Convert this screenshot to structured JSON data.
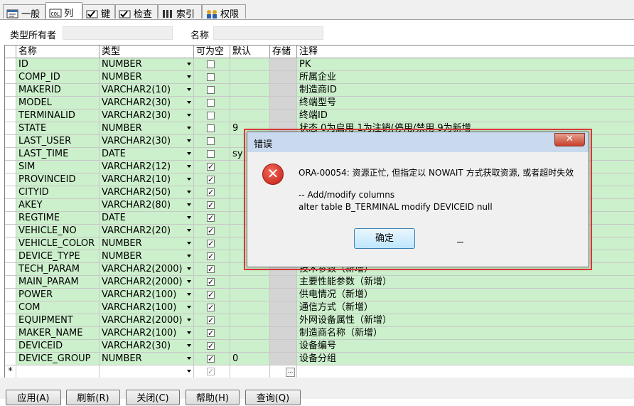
{
  "tabs": [
    {
      "label": "一般"
    },
    {
      "label": "列"
    },
    {
      "label": "键"
    },
    {
      "label": "检查"
    },
    {
      "label": "索引"
    },
    {
      "label": "权限"
    }
  ],
  "form": {
    "owner_label": "类型所有者",
    "owner_value": "",
    "name_label": "名称",
    "name_value": ""
  },
  "grid": {
    "headers": {
      "name": "名称",
      "type": "类型",
      "nullable": "可为空",
      "default": "默认",
      "storage": "存储",
      "comment": "注释"
    },
    "rows": [
      {
        "name": "ID",
        "type": "NUMBER",
        "nullable": false,
        "default": "",
        "comment": "PK"
      },
      {
        "name": "COMP_ID",
        "type": "NUMBER",
        "nullable": false,
        "default": "",
        "comment": "所属企业"
      },
      {
        "name": "MAKERID",
        "type": "VARCHAR2(10)",
        "nullable": false,
        "default": "",
        "comment": "制造商ID"
      },
      {
        "name": "MODEL",
        "type": "VARCHAR2(30)",
        "nullable": false,
        "default": "",
        "comment": "终端型号"
      },
      {
        "name": "TERMINALID",
        "type": "VARCHAR2(30)",
        "nullable": false,
        "default": "",
        "comment": "终端ID"
      },
      {
        "name": "STATE",
        "type": "NUMBER",
        "nullable": false,
        "default": "9",
        "comment": "状态 0为启用 1为注销(停用/禁用 9为新增"
      },
      {
        "name": "LAST_USER",
        "type": "VARCHAR2(30)",
        "nullable": false,
        "default": "",
        "comment": ""
      },
      {
        "name": "LAST_TIME",
        "type": "DATE",
        "nullable": false,
        "default": "sy",
        "comment": ""
      },
      {
        "name": "SIM",
        "type": "VARCHAR2(12)",
        "nullable": true,
        "default": "",
        "comment": ""
      },
      {
        "name": "PROVINCEID",
        "type": "VARCHAR2(10)",
        "nullable": true,
        "default": "",
        "comment": ""
      },
      {
        "name": "CITYID",
        "type": "VARCHAR2(50)",
        "nullable": true,
        "default": "",
        "comment": ""
      },
      {
        "name": "AKEY",
        "type": "VARCHAR2(80)",
        "nullable": true,
        "default": "",
        "comment": ""
      },
      {
        "name": "REGTIME",
        "type": "DATE",
        "nullable": true,
        "default": "",
        "comment": ""
      },
      {
        "name": "VEHICLE_NO",
        "type": "VARCHAR2(20)",
        "nullable": true,
        "default": "",
        "comment": ""
      },
      {
        "name": "VEHICLE_COLOR",
        "type": "NUMBER",
        "nullable": true,
        "default": "",
        "comment": ""
      },
      {
        "name": "DEVICE_TYPE",
        "type": "NUMBER",
        "nullable": true,
        "default": "",
        "comment": ""
      },
      {
        "name": "TECH_PARAM",
        "type": "VARCHAR2(2000)",
        "nullable": true,
        "default": "",
        "comment": "技术参数（新增）"
      },
      {
        "name": "MAIN_PARAM",
        "type": "VARCHAR2(2000)",
        "nullable": true,
        "default": "",
        "comment": "主要性能参数（新增）"
      },
      {
        "name": "POWER",
        "type": "VARCHAR2(100)",
        "nullable": true,
        "default": "",
        "comment": "供电情况（新增）"
      },
      {
        "name": "COM",
        "type": "VARCHAR2(100)",
        "nullable": true,
        "default": "",
        "comment": "通信方式（新增）"
      },
      {
        "name": "EQUIPMENT",
        "type": "VARCHAR2(2000)",
        "nullable": true,
        "default": "",
        "comment": "外网设备属性（新增）"
      },
      {
        "name": "MAKER_NAME",
        "type": "VARCHAR2(100)",
        "nullable": true,
        "default": "",
        "comment": "制造商名称（新增）"
      },
      {
        "name": "DEVICEID",
        "type": "VARCHAR2(30)",
        "nullable": true,
        "default": "",
        "comment": "设备编号"
      },
      {
        "name": "DEVICE_GROUP",
        "type": "NUMBER",
        "nullable": true,
        "default": "0",
        "comment": "设备分组"
      }
    ],
    "new_row_marker": "*",
    "ellipsis": "..."
  },
  "buttons": [
    {
      "label": "应用(A)"
    },
    {
      "label": "刷新(R)"
    },
    {
      "label": "关闭(C)"
    },
    {
      "label": "帮助(H)"
    },
    {
      "label": "查询(Q)"
    }
  ],
  "dialog": {
    "title": "错误",
    "close_glyph": "✕",
    "error_glyph": "✕",
    "message_line1": "ORA-00054: 资源正忙, 但指定以 NOWAIT 方式获取资源, 或者超时失效",
    "message_line2": "-- Add/modify columns",
    "message_line3": "alter table B_TERMINAL modify DEVICEID null",
    "ok_label": "确定"
  },
  "colors": {
    "row_green": "#ccefcc",
    "dialog_highlight": "#e23b3b",
    "title_bar": "#c9d9ee"
  }
}
